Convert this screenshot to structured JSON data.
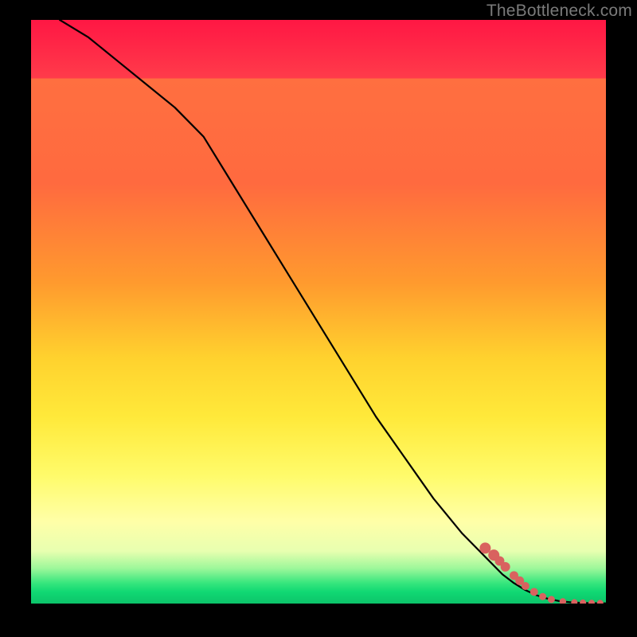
{
  "watermark": "TheBottleneck.com",
  "colors": {
    "gradient_top": "#ff1744",
    "gradient_mid1": "#ff9a2e",
    "gradient_mid2": "#ffe93a",
    "gradient_bottom": "#10d873",
    "curve": "#000000",
    "marker": "#d9625f",
    "frame": "#000000"
  },
  "chart_data": {
    "type": "line",
    "title": "",
    "xlabel": "",
    "ylabel": "",
    "xlim": [
      0,
      100
    ],
    "ylim": [
      0,
      100
    ],
    "grid": false,
    "legend": false,
    "series": [
      {
        "name": "curve",
        "x": [
          5,
          10,
          15,
          20,
          25,
          30,
          35,
          40,
          45,
          50,
          55,
          60,
          65,
          70,
          75,
          80,
          82,
          84,
          86,
          88,
          90,
          92,
          94,
          96,
          98,
          100
        ],
        "y": [
          100,
          97,
          93,
          89,
          85,
          80,
          72,
          64,
          56,
          48,
          40,
          32,
          25,
          18,
          12,
          7,
          5,
          3.5,
          2.3,
          1.4,
          0.8,
          0.4,
          0.2,
          0.1,
          0.05,
          0.03
        ]
      }
    ],
    "markers": {
      "name": "highlighted-points",
      "x": [
        79,
        80.5,
        81.5,
        82.5,
        84,
        85,
        86,
        87.5,
        89,
        90.5,
        92.5,
        94.5,
        96,
        97.5,
        99
      ],
      "y": [
        9.5,
        8.3,
        7.3,
        6.3,
        4.8,
        3.9,
        3.0,
        2.0,
        1.2,
        0.7,
        0.35,
        0.2,
        0.15,
        0.1,
        0.08
      ],
      "r": [
        7,
        7,
        6,
        6,
        5.5,
        5.5,
        5,
        5,
        4.5,
        4.5,
        4.2,
        4,
        4,
        4,
        4
      ]
    }
  }
}
